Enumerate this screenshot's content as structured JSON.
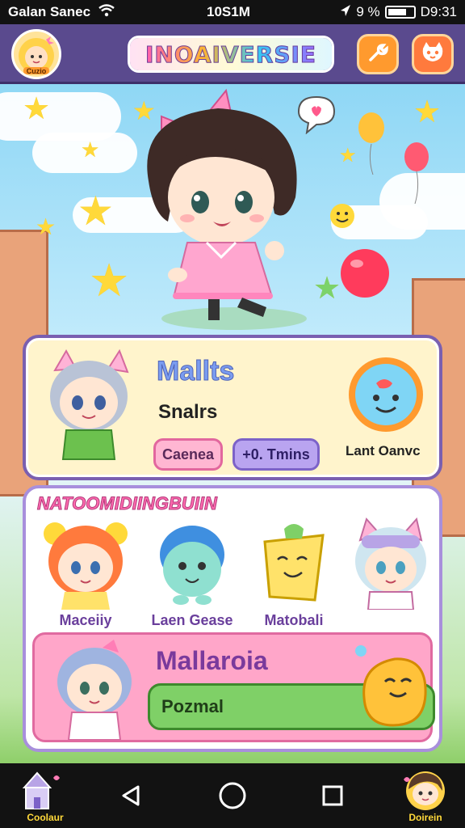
{
  "status_bar": {
    "carrier": "Galan Sanec",
    "clock": "10S1M",
    "battery": "9 %",
    "battery_extra": "D9:31"
  },
  "header": {
    "logo_text": "INOAIVERSIE",
    "avatar_caption": "Cuzio"
  },
  "card1": {
    "title": "Mallts",
    "subtitle": "Snalrs",
    "pill1": "Caenea",
    "pill2": "+0. Tmins",
    "side_label": "Lant Oanvc"
  },
  "panel2": {
    "banner": "NATOOMIDIINGBUIIN",
    "characters": [
      {
        "label": "Maceiiy"
      },
      {
        "label": "Laen Gease"
      },
      {
        "label": "Matobali"
      }
    ],
    "feature": {
      "title": "Mallaroia",
      "button": "Pozmal"
    }
  },
  "bottom_nav": {
    "left_caption": "Coolaur",
    "right_caption": "Doirein"
  },
  "colors": {
    "header_bg": "#5a4a8e",
    "accent_pink": "#ffa6c9",
    "accent_orange": "#ff9a2e",
    "accent_green": "#7fd067"
  }
}
